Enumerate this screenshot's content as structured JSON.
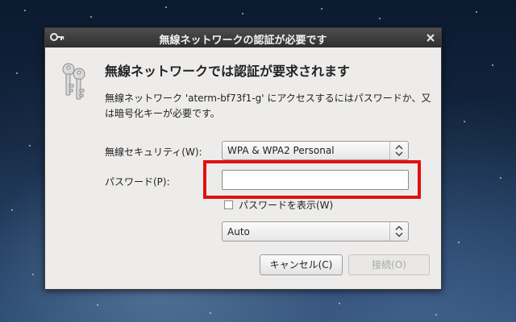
{
  "dialog": {
    "title": "無線ネットワークの認証が必要です",
    "heading": "無線ネットワークでは認証が要求されます",
    "description": "無線ネットワーク 'aterm-bf73f1-g' にアクセスするにはパスワードか、又は暗号化キーが必要です。"
  },
  "form": {
    "security_label": "無線セキュリティ(W):",
    "security_value": "WPA & WPA2 Personal",
    "password_label": "パスワード(P):",
    "password_value": "",
    "show_password_label": "パスワードを表示(W)",
    "show_password_checked": false,
    "auth_value": "Auto"
  },
  "buttons": {
    "cancel": "キャンセル(C)",
    "connect": "接続(O)"
  },
  "colors": {
    "highlight": "#e01010",
    "titlebar": "#3a3a3a",
    "dialog_bg": "#edeceb"
  },
  "icons": {
    "title": "key-icon",
    "close": "close-icon",
    "dialog": "keys-icon",
    "combo_arrow": "up-down-arrow-icon"
  }
}
